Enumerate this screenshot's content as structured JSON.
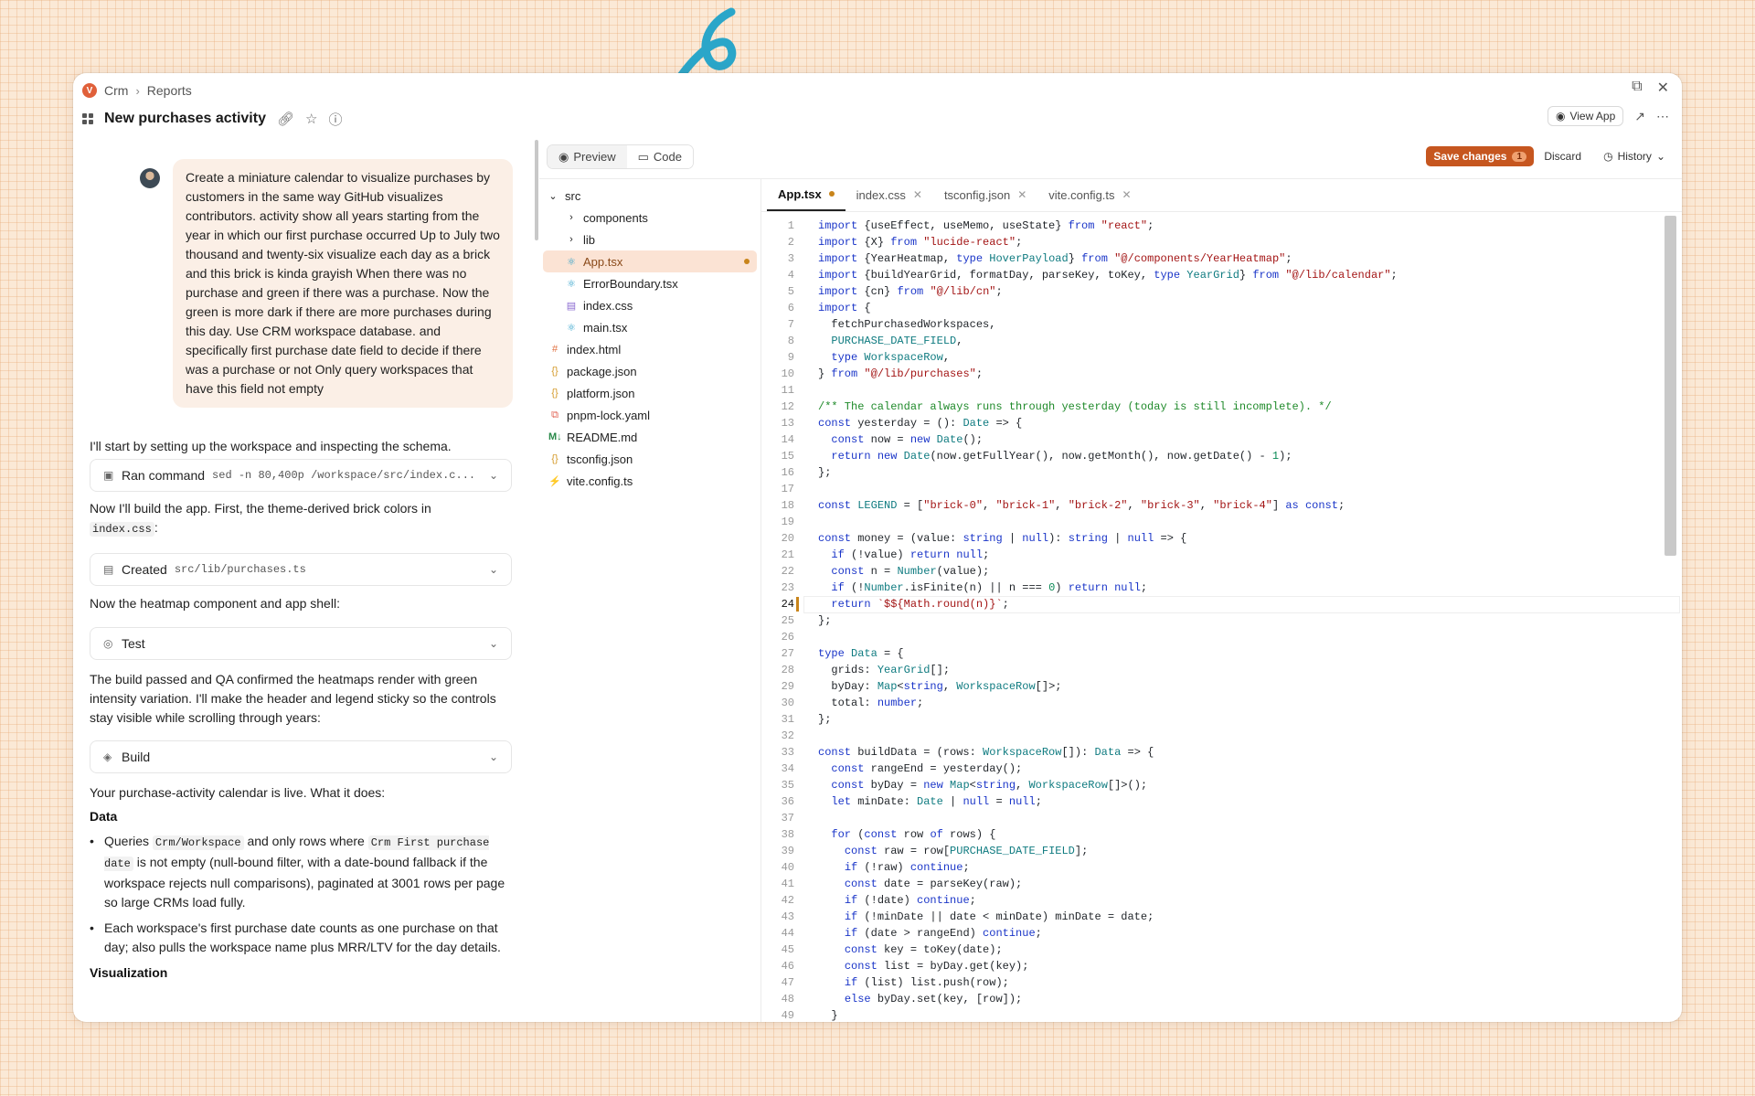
{
  "colors": {
    "accent": "#c6561f",
    "background": "#fbe9d6",
    "selected_file_bg": "#fbe3d4",
    "modified_dot": "#c8841a"
  },
  "breadcrumb": {
    "root": "Crm",
    "current": "Reports"
  },
  "page": {
    "title": "New purchases activity"
  },
  "header": {
    "view_app_label": "View App"
  },
  "user_message": "Create a miniature calendar to visualize purchases by customers in the same way GitHub visualizes contributors. activity show all years starting from the year in which our first purchase occurred Up to July two thousand and twenty-six visualize each day as a brick and this brick is kinda grayish When there was no purchase and green if there was a purchase. Now the green is more dark if there are more purchases during this day. Use CRM workspace database. and specifically first purchase date field to decide if there was a purchase or not Only query workspaces that have this field not empty",
  "assistant": {
    "msg1": "I'll start by setting up the workspace and inspecting the schema.",
    "tool1": {
      "label": "Ran command",
      "detail": "sed -n 80,400p /workspace/src/index.c..."
    },
    "msg2_pre": "Now I'll build the app. First, the theme-derived brick colors in",
    "msg2_code": "index.css",
    "msg2_post": ":",
    "tool2": {
      "label": "Created",
      "detail": "src/lib/purchases.ts"
    },
    "msg3": "Now the heatmap component and app shell:",
    "tool3": {
      "label": "Test"
    },
    "msg4": "The build passed and QA confirmed the heatmaps render with green intensity variation. I'll make the header and legend sticky so the controls stay visible while scrolling through years:",
    "tool4": {
      "label": "Build"
    },
    "msg5": "Your purchase-activity calendar is live. What it does:",
    "heading_data": "Data",
    "bullet1": {
      "pre": "Queries",
      "code1": "Crm/Workspace",
      "mid": "and only rows where",
      "code2": "Crm First purchase date",
      "post": "is not empty (null-bound filter, with a date-bound fallback if the workspace rejects null comparisons), paginated at 3001 rows per page so large CRMs load fully."
    },
    "bullet2": "Each workspace's first purchase date counts as one purchase on that day; also pulls the workspace name plus MRR/LTV for the day details.",
    "heading_viz": "Visualization"
  },
  "editor": {
    "preview_label": "Preview",
    "code_label": "Code",
    "save_label": "Save changes",
    "save_count": "1",
    "discard_label": "Discard",
    "history_label": "History",
    "tabs": [
      {
        "label": "App.tsx"
      },
      {
        "label": "index.css"
      },
      {
        "label": "tsconfig.json"
      },
      {
        "label": "vite.config.ts"
      }
    ],
    "tree": {
      "src": "src",
      "components": "components",
      "lib": "lib",
      "app": "App.tsx",
      "errorboundary": "ErrorBoundary.tsx",
      "indexcss": "index.css",
      "main": "main.tsx",
      "indexhtml": "index.html",
      "package": "package.json",
      "platform": "platform.json",
      "pnpm": "pnpm-lock.yaml",
      "readme": "README.md",
      "tsconfig": "tsconfig.json",
      "vite": "vite.config.ts"
    },
    "cursor_line": 24,
    "code_lines": [
      "import {useEffect, useMemo, useState} from \"react\";",
      "import {X} from \"lucide-react\";",
      "import {YearHeatmap, type HoverPayload} from \"@/components/YearHeatmap\";",
      "import {buildYearGrid, formatDay, parseKey, toKey, type YearGrid} from \"@/lib/calendar\";",
      "import {cn} from \"@/lib/cn\";",
      "import {",
      "  fetchPurchasedWorkspaces,",
      "  PURCHASE_DATE_FIELD,",
      "  type WorkspaceRow,",
      "} from \"@/lib/purchases\";",
      "",
      "/** The calendar always runs through yesterday (today is still incomplete). */",
      "const yesterday = (): Date => {",
      "  const now = new Date();",
      "  return new Date(now.getFullYear(), now.getMonth(), now.getDate() - 1);",
      "};",
      "",
      "const LEGEND = [\"brick-0\", \"brick-1\", \"brick-2\", \"brick-3\", \"brick-4\"] as const;",
      "",
      "const money = (value: string | null): string | null => {",
      "  if (!value) return null;",
      "  const n = Number(value);",
      "  if (!Number.isFinite(n) || n === 0) return null;",
      "  return `$${Math.round(n)}`;",
      "};",
      "",
      "type Data = {",
      "  grids: YearGrid[];",
      "  byDay: Map<string, WorkspaceRow[]>;",
      "  total: number;",
      "};",
      "",
      "const buildData = (rows: WorkspaceRow[]): Data => {",
      "  const rangeEnd = yesterday();",
      "  const byDay = new Map<string, WorkspaceRow[]>();",
      "  let minDate: Date | null = null;",
      "",
      "  for (const row of rows) {",
      "    const raw = row[PURCHASE_DATE_FIELD];",
      "    if (!raw) continue;",
      "    const date = parseKey(raw);",
      "    if (!date) continue;",
      "    if (!minDate || date < minDate) minDate = date;",
      "    if (date > rangeEnd) continue;",
      "    const key = toKey(date);",
      "    const list = byDay.get(key);",
      "    if (list) list.push(row);",
      "    else byDay.set(key, [row]);",
      "  }"
    ]
  }
}
